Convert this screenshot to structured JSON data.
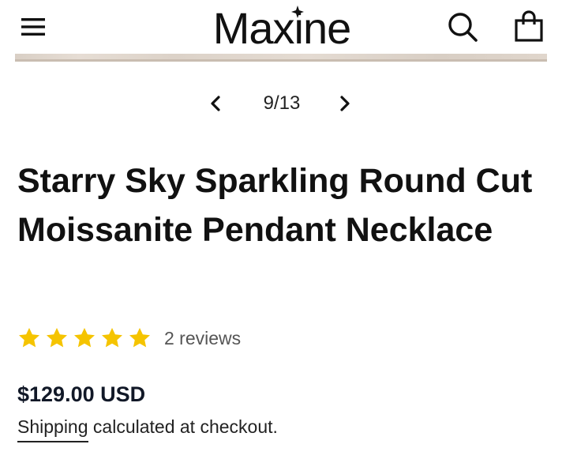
{
  "header": {
    "brand": "Maxine",
    "menu_icon": "hamburger-icon",
    "search_icon": "search-icon",
    "cart_icon": "shopping-bag-icon"
  },
  "gallery": {
    "pager": {
      "current": 9,
      "total": 13,
      "label": "9/13",
      "prev_icon": "chevron-left-icon",
      "next_icon": "chevron-right-icon"
    }
  },
  "product": {
    "title": "Starry Sky Sparkling Round Cut Moissanite Pendant Necklace",
    "rating": {
      "stars": 5,
      "max": 5,
      "reviews_label": "2 reviews",
      "star_icon": "star-icon",
      "star_color": "#F5C400"
    },
    "price": "$129.00 USD",
    "shipping": {
      "link": "Shipping",
      "text": " calculated at checkout."
    }
  }
}
